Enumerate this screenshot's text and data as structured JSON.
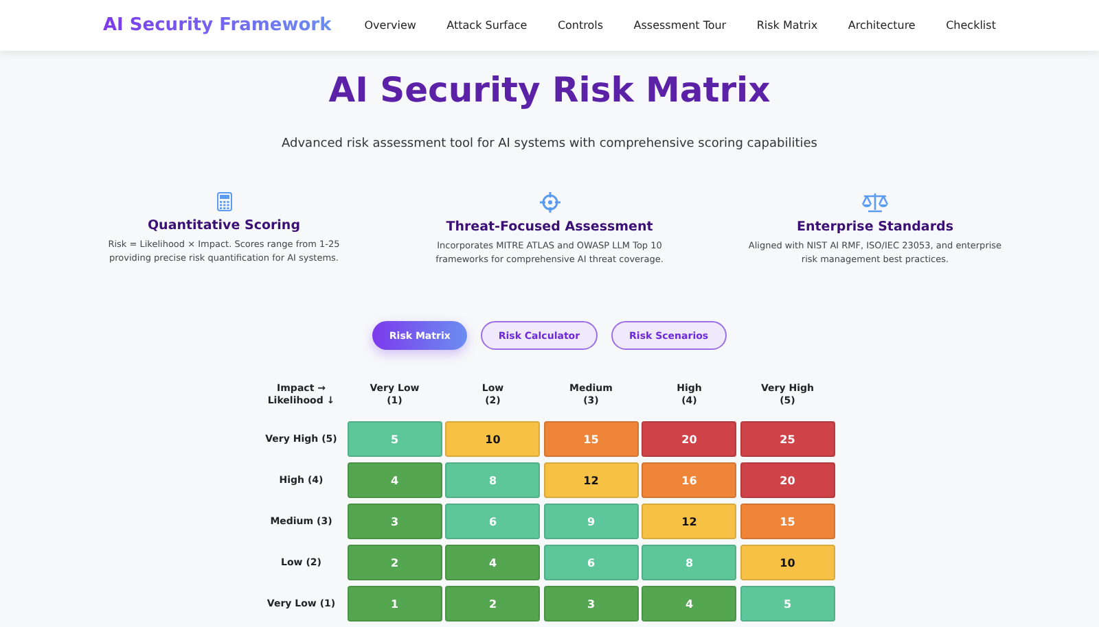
{
  "nav": {
    "brand": "AI Security Framework",
    "links": [
      {
        "label": "Overview",
        "selected": false
      },
      {
        "label": "Attack Surface",
        "selected": false
      },
      {
        "label": "Controls",
        "selected": false
      },
      {
        "label": "Assessment Tour",
        "selected": false
      },
      {
        "label": "Risk Matrix",
        "selected": false
      },
      {
        "label": "Architecture",
        "selected": false
      },
      {
        "label": "Checklist",
        "selected": false
      }
    ]
  },
  "title": "AI Security Risk Matrix",
  "subtitle": "Advanced risk assessment tool for AI systems with comprehensive scoring capabilities",
  "features": [
    {
      "kind": "calculator",
      "title": "Quantitative Scoring",
      "text": "Risk = Likelihood × Impact. Scores range from 1-25 providing precise risk quantification for AI systems."
    },
    {
      "kind": "target",
      "title": "Threat-Focused Assessment",
      "text": "Incorporates MITRE ATLAS and OWASP LLM Top 10 frameworks for comprehensive AI threat coverage."
    },
    {
      "kind": "scale",
      "title": "Enterprise Standards",
      "text": "Aligned with NIST AI RMF, ISO/IEC 23053, and enterprise risk management best practices."
    }
  ],
  "tabs": [
    {
      "label": "Risk Matrix",
      "selected": true
    },
    {
      "label": "Risk Calculator",
      "selected": false
    },
    {
      "label": "Risk Scenarios",
      "selected": false
    }
  ],
  "matrix": {
    "corner": {
      "impact": "Impact →",
      "likelihood": "Likelihood ↓"
    },
    "columns": [
      {
        "name": "Very Low",
        "score": "(1)"
      },
      {
        "name": "Low",
        "score": "(2)"
      },
      {
        "name": "Medium",
        "score": "(3)"
      },
      {
        "name": "High",
        "score": "(4)"
      },
      {
        "name": "Very High",
        "score": "(5)"
      }
    ],
    "rows": [
      {
        "label": "Very High (5)",
        "cells": [
          {
            "value": "5",
            "color": "#5ec79a"
          },
          {
            "value": "10",
            "color": "#f6c144"
          },
          {
            "value": "15",
            "color": "#ef8539"
          },
          {
            "value": "20",
            "color": "#cf4248"
          },
          {
            "value": "25",
            "color": "#cf4248"
          }
        ]
      },
      {
        "label": "High (4)",
        "cells": [
          {
            "value": "4",
            "color": "#55a650"
          },
          {
            "value": "8",
            "color": "#5ec79a"
          },
          {
            "value": "12",
            "color": "#f6c144"
          },
          {
            "value": "16",
            "color": "#ef8539"
          },
          {
            "value": "20",
            "color": "#cf4248"
          }
        ]
      },
      {
        "label": "Medium (3)",
        "cells": [
          {
            "value": "3",
            "color": "#55a650"
          },
          {
            "value": "6",
            "color": "#5ec79a"
          },
          {
            "value": "9",
            "color": "#5ec79a"
          },
          {
            "value": "12",
            "color": "#f6c144"
          },
          {
            "value": "15",
            "color": "#ef8539"
          }
        ]
      },
      {
        "label": "Low (2)",
        "cells": [
          {
            "value": "2",
            "color": "#55a650"
          },
          {
            "value": "4",
            "color": "#55a650"
          },
          {
            "value": "6",
            "color": "#5ec79a"
          },
          {
            "value": "8",
            "color": "#5ec79a"
          },
          {
            "value": "10",
            "color": "#f6c144"
          }
        ]
      },
      {
        "label": "Very Low (1)",
        "cells": [
          {
            "value": "1",
            "color": "#55a650"
          },
          {
            "value": "2",
            "color": "#55a650"
          },
          {
            "value": "3",
            "color": "#55a650"
          },
          {
            "value": "4",
            "color": "#55a650"
          },
          {
            "value": "5",
            "color": "#5ec79a"
          }
        ]
      }
    ]
  }
}
